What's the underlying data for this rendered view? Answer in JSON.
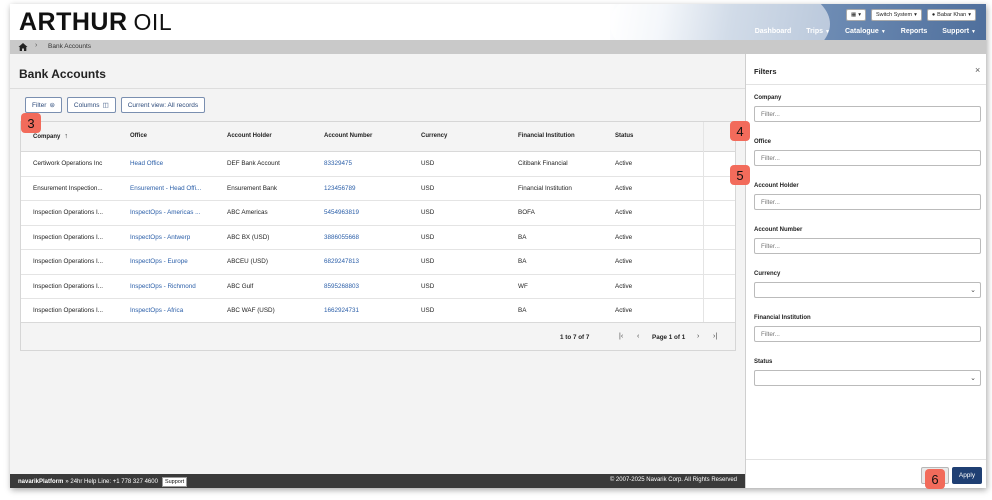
{
  "brand": {
    "name_bold": "ARTHUR",
    "name_thin": "OIL"
  },
  "top_tools": {
    "switch_system": "Switch System",
    "user": "Babar Khan"
  },
  "nav": [
    {
      "label": "Dashboard",
      "has_caret": false
    },
    {
      "label": "Trips",
      "has_caret": true
    },
    {
      "label": "Catalogue",
      "has_caret": true
    },
    {
      "label": "Reports",
      "has_caret": false
    },
    {
      "label": "Support",
      "has_caret": true
    }
  ],
  "breadcrumb": {
    "current": "Bank Accounts"
  },
  "page": {
    "title": "Bank Accounts"
  },
  "toolbar": {
    "filter": "Filter",
    "columns": "Columns",
    "view": "Current view: All records"
  },
  "table": {
    "headers": [
      "Company",
      "Office",
      "Account Holder",
      "Account Number",
      "Currency",
      "Financial Institution",
      "Status"
    ],
    "rows": [
      [
        "Certiwork Operations Inc",
        "Head Office",
        "DEF Bank Account",
        "83329475",
        "USD",
        "Citibank Financial",
        "Active"
      ],
      [
        "Ensurement Inspection...",
        "Ensurement - Head Offi...",
        "Ensurement Bank",
        "123456789",
        "USD",
        "Financial Institution",
        "Active"
      ],
      [
        "Inspection Operations I...",
        "InspectOps - Americas ...",
        "ABC Americas",
        "5454963819",
        "USD",
        "BOFA",
        "Active"
      ],
      [
        "Inspection Operations I...",
        "InspectOps - Antwerp",
        "ABC BX (USD)",
        "3886055668",
        "USD",
        "BA",
        "Active"
      ],
      [
        "Inspection Operations I...",
        "InspectOps - Europe",
        "ABCEU (USD)",
        "6829247813",
        "USD",
        "BA",
        "Active"
      ],
      [
        "Inspection Operations I...",
        "InspectOps - Richmond",
        "ABC Gulf",
        "8595268803",
        "USD",
        "WF",
        "Active"
      ],
      [
        "Inspection Operations I...",
        "InspectOps - Africa",
        "ABC WAF (USD)",
        "1662924731",
        "USD",
        "BA",
        "Active"
      ]
    ],
    "pager": {
      "count": "1 to 7 of 7",
      "page": "Page 1 of 1"
    }
  },
  "filters": {
    "title": "Filters",
    "fields": [
      {
        "label": "Company",
        "type": "text",
        "placeholder": "Filter..."
      },
      {
        "label": "Office",
        "type": "text",
        "placeholder": "Filter..."
      },
      {
        "label": "Account Holder",
        "type": "text",
        "placeholder": "Filter..."
      },
      {
        "label": "Account Number",
        "type": "text",
        "placeholder": "Filter..."
      },
      {
        "label": "Currency",
        "type": "select",
        "placeholder": ""
      },
      {
        "label": "Financial Institution",
        "type": "text",
        "placeholder": "Filter..."
      },
      {
        "label": "Status",
        "type": "select",
        "placeholder": ""
      }
    ],
    "apply": "Apply"
  },
  "footer": {
    "brand": "navarikPlatform",
    "helpline": "» 24hr Help Line: +1 778 327 4600",
    "support": "Support",
    "copyright": "© 2007-2025 Navarik Corp. All Rights Reserved"
  },
  "badges": {
    "b3": "3",
    "b4": "4",
    "b5": "5",
    "b6": "6"
  },
  "colors": {
    "accent": "#1f3f73",
    "link": "#2a5ea8",
    "badge": "#f26b5b",
    "footer_bg": "#3a3a3a"
  }
}
